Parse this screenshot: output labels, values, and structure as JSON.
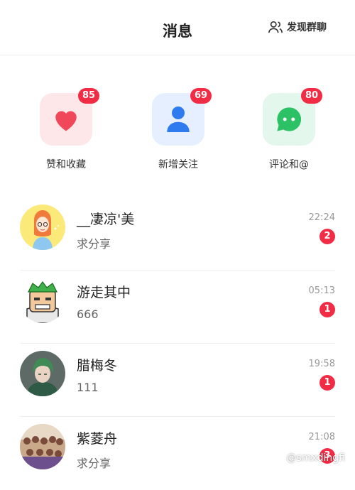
{
  "header": {
    "title": "消息",
    "discover_label": "发现群聊"
  },
  "shortcuts": [
    {
      "label": "赞和收藏",
      "badge": "85",
      "icon": "heart-icon",
      "bg": "#fde7e9",
      "color": "#f0485a"
    },
    {
      "label": "新增关注",
      "badge": "69",
      "icon": "person-icon",
      "bg": "#e6efff",
      "color": "#2e7bf0"
    },
    {
      "label": "评论和@",
      "badge": "80",
      "icon": "chat-icon",
      "bg": "#e3f7ec",
      "color": "#2cc165"
    }
  ],
  "messages": [
    {
      "name": "__凄凉'美",
      "preview": "求分享",
      "time": "22:24",
      "badge": "2"
    },
    {
      "name": "游走其中",
      "preview": "666",
      "time": "05:13",
      "badge": "1"
    },
    {
      "name": "腊梅冬",
      "preview": "111",
      "time": "19:58",
      "badge": "1"
    },
    {
      "name": "紫菱舟",
      "preview": "求分享",
      "time": "21:08",
      "badge": "3"
    }
  ],
  "watermark": "@smxdingfi",
  "colors": {
    "badge": "#f22c45",
    "divider": "#eeeeee"
  }
}
